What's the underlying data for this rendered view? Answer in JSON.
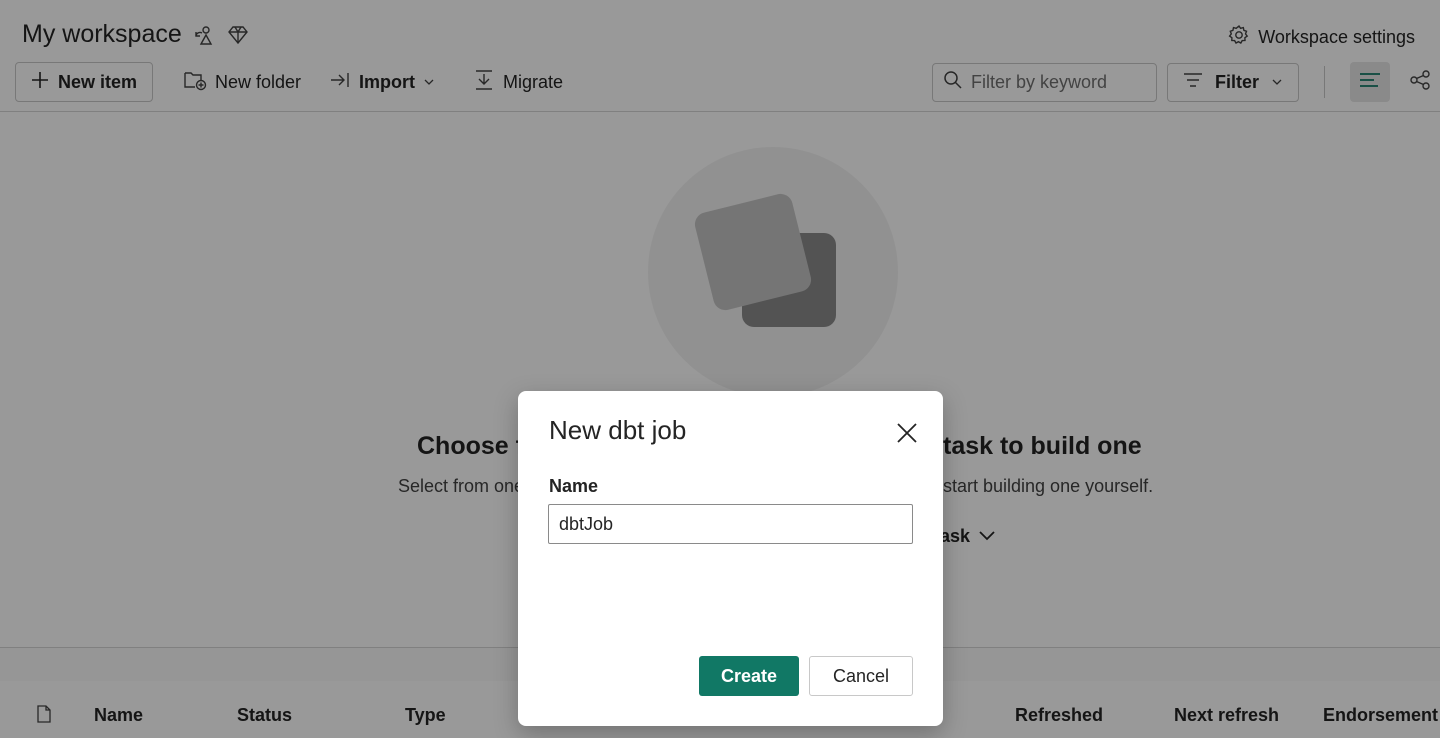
{
  "workspace": {
    "title": "My workspace",
    "settings_label": "Workspace settings",
    "icons": [
      "workspace-identity-icon",
      "premium-diamond-icon",
      "gear-icon"
    ]
  },
  "toolbar": {
    "new_item_label": "New item",
    "new_folder_label": "New folder",
    "import_label": "Import",
    "migrate_label": "Migrate",
    "search_placeholder": "Filter by keyword",
    "filter_label": "Filter"
  },
  "empty_state": {
    "title_left": "Choose f",
    "title_right": "task to build one",
    "subtitle_left": "Select from one",
    "subtitle_right": "start building one yourself.",
    "task_label": "ask"
  },
  "table": {
    "columns": [
      "Name",
      "Status",
      "Type",
      "Refreshed",
      "Next refresh",
      "Endorsement"
    ]
  },
  "dialog": {
    "title": "New dbt job",
    "name_label": "Name",
    "name_value": "dbtJob",
    "create_label": "Create",
    "cancel_label": "Cancel"
  },
  "colors": {
    "primary": "#117865",
    "overlay": "rgba(0,0,0,0.4)"
  }
}
